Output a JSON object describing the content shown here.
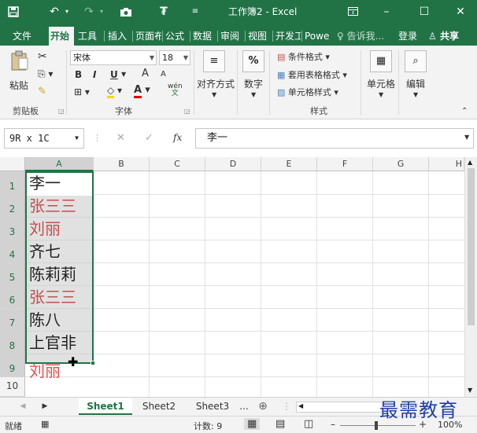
{
  "window": {
    "title": "工作簿2 - Excel",
    "save_icon": "save-icon",
    "undo_icon": "undo-icon",
    "redo_icon": "redo-icon",
    "camera_icon": "camera-icon",
    "customize_icon": "customize-qat-icon",
    "more_icon": "qat-dropdown-icon",
    "ribbon_display_icon": "ribbon-display-options-icon",
    "minimize_label": "–",
    "maximize_label": "☐",
    "close_label": "✕"
  },
  "tabs": [
    {
      "label": "文件"
    },
    {
      "label": "开始",
      "active": true
    },
    {
      "label": "工具"
    },
    {
      "label": "插入"
    },
    {
      "label": "页面布"
    },
    {
      "label": "公式"
    },
    {
      "label": "数据"
    },
    {
      "label": "审阅"
    },
    {
      "label": "视图"
    },
    {
      "label": "开发工"
    },
    {
      "label": "Powe"
    }
  ],
  "tell_me": "告诉我...",
  "login": "登录",
  "share": "共享",
  "ribbon": {
    "clipboard": {
      "paste_label": "粘贴",
      "group_label": "剪贴板"
    },
    "font": {
      "font_name": "宋体",
      "font_size": "18",
      "bold": "B",
      "italic": "I",
      "underline": "U",
      "grow": "A",
      "shrink": "A",
      "font_color_letter": "A",
      "phonetic_top": "wén",
      "phonetic_bottom": "文",
      "group_label": "字体"
    },
    "alignment": {
      "label": "对齐方式"
    },
    "number": {
      "label": "数字",
      "symbol": "%"
    },
    "styles": {
      "conditional": "条件格式",
      "table": "套用表格格式",
      "cell_styles": "单元格样式",
      "group_label": "样式"
    },
    "cells": {
      "label": "单元格"
    },
    "editing": {
      "label": "编辑"
    }
  },
  "formula_bar": {
    "name_box": "9R x 1C",
    "cancel": "✕",
    "enter": "✓",
    "fx": "fx",
    "content": "李一"
  },
  "grid": {
    "columns": [
      "A",
      "B",
      "C",
      "D",
      "E",
      "F",
      "G",
      "H"
    ],
    "rows": [
      "1",
      "2",
      "3",
      "4",
      "5",
      "6",
      "7",
      "8",
      "9",
      "10"
    ],
    "cells": [
      {
        "text": "李一",
        "color": "#222222"
      },
      {
        "text": "张三三",
        "color": "#c0504d"
      },
      {
        "text": "刘丽",
        "color": "#c0504d"
      },
      {
        "text": "齐七",
        "color": "#222222"
      },
      {
        "text": "陈莉莉",
        "color": "#222222"
      },
      {
        "text": "张三三",
        "color": "#c0504d"
      },
      {
        "text": "陈八",
        "color": "#222222"
      },
      {
        "text": "上官非",
        "color": "#222222"
      },
      {
        "text": "刘丽",
        "color": "#e05050"
      }
    ]
  },
  "sheets": {
    "tabs": [
      {
        "label": "Sheet1",
        "active": true
      },
      {
        "label": "Sheet2"
      },
      {
        "label": "Sheet3"
      }
    ],
    "more": "...",
    "add": "⊕"
  },
  "status": {
    "mode": "就绪",
    "count": "计数: 9",
    "zoom": "100%",
    "zoom_minus": "–",
    "zoom_plus": "+"
  },
  "watermark": "最需教育",
  "colors": {
    "brand": "#217346",
    "duplicate_text": "#c0504d"
  }
}
